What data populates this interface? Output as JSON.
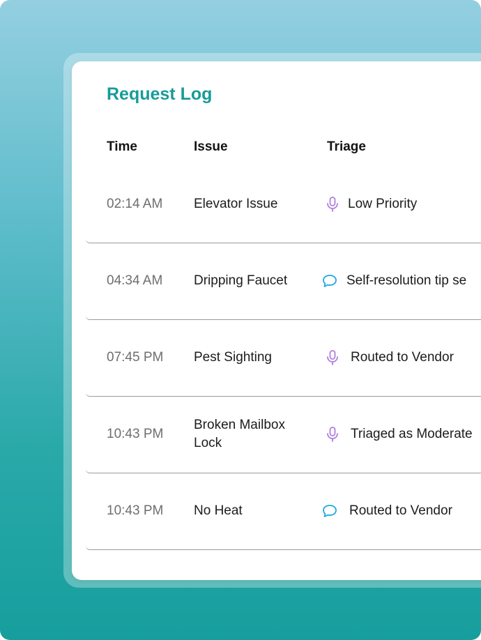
{
  "title": "Request Log",
  "columns": {
    "time": "Time",
    "issue": "Issue",
    "triage": "Triage"
  },
  "rows": [
    {
      "time": "02:14 AM",
      "issue": "Elevator Issue",
      "triage": "Low Priority",
      "channel": "microphone-icon"
    },
    {
      "time": "04:34 AM",
      "issue": "Dripping Faucet",
      "triage": "Self-resolution tip se",
      "channel": "chat-bubble-icon"
    },
    {
      "time": "07:45 PM",
      "issue": "Pest Sighting",
      "triage": "Routed to Vendor",
      "channel": "microphone-icon"
    },
    {
      "time": "10:43 PM",
      "issue": "Broken Mailbox Lock",
      "triage": "Triaged as Moderate",
      "channel": "microphone-icon"
    },
    {
      "time": "10:43 PM",
      "issue": "No Heat",
      "triage": "Routed to Vendor",
      "channel": "chat-bubble-icon"
    }
  ],
  "colors": {
    "accent": "#179c99",
    "microphone": "#b07ee0",
    "chat": "#1da8e0",
    "divider": "#9a9a9a"
  }
}
